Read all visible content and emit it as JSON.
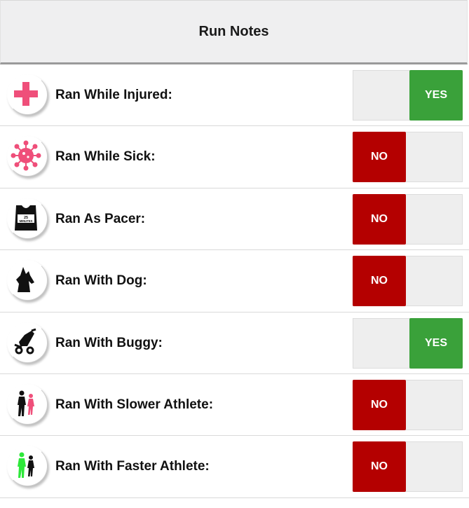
{
  "header": {
    "title": "Run Notes"
  },
  "rows": [
    {
      "label": "Ran While Injured:",
      "value": "YES",
      "icon": "medical-cross-icon"
    },
    {
      "label": "Ran While Sick:",
      "value": "NO",
      "icon": "virus-icon"
    },
    {
      "label": "Ran As Pacer:",
      "value": "NO",
      "icon": "pacer-vest-icon",
      "icon_text": "25 MINUTES"
    },
    {
      "label": "Ran With Dog:",
      "value": "NO",
      "icon": "dog-icon"
    },
    {
      "label": "Ran With Buggy:",
      "value": "YES",
      "icon": "buggy-icon"
    },
    {
      "label": "Ran With Slower Athlete:",
      "value": "NO",
      "icon": "slower-athlete-icon"
    },
    {
      "label": "Ran With Faster Athlete:",
      "value": "NO",
      "icon": "faster-athlete-icon"
    }
  ],
  "colors": {
    "yes": "#3aa13a",
    "no": "#b40000",
    "accent_pink": "#ef4f7a",
    "accent_green": "#2ee83a"
  }
}
